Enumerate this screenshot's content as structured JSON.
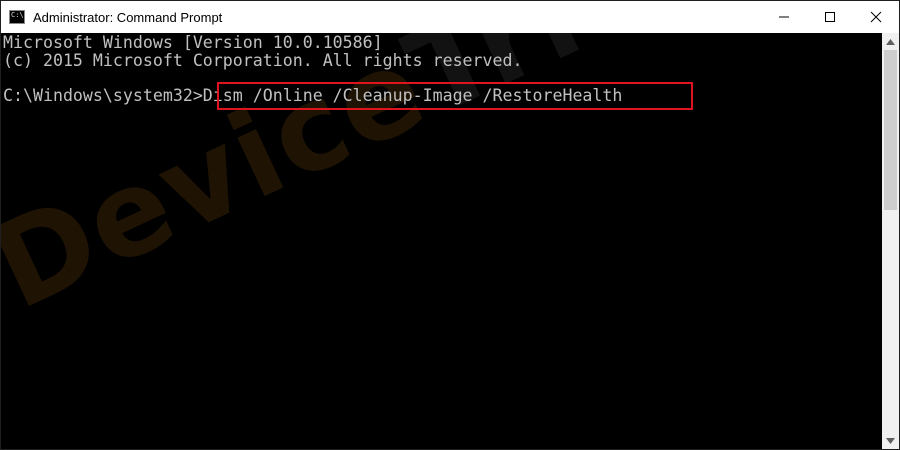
{
  "window": {
    "title": "Administrator: Command Prompt",
    "app_icon_glyph": "C:\\"
  },
  "console": {
    "lines": [
      "Microsoft Windows [Version 10.0.10586]",
      "(c) 2015 Microsoft Corporation. All rights reserved.",
      "",
      "C:\\Windows\\system32>Dism /Online /Cleanup-Image /RestoreHealth"
    ],
    "highlight_color": "#e0141e"
  },
  "watermark": {
    "part1": "Device",
    "part2": "Tricks"
  },
  "colors": {
    "console_bg": "#000000",
    "console_text": "#c0c0c0",
    "titlebar_bg": "#ffffff"
  }
}
